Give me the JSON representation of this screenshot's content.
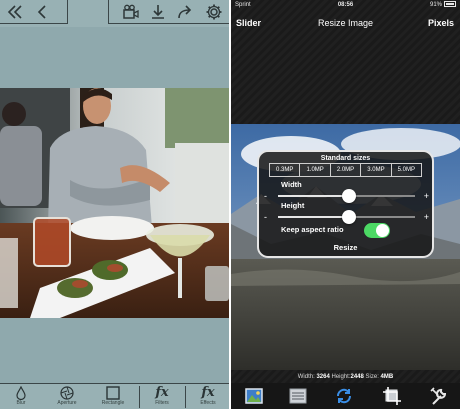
{
  "left_app": {
    "top_toolbar": {
      "icons": [
        "double-chevron-left-icon",
        "chevron-left-icon",
        "video-camera-icon",
        "download-icon",
        "share-arrow-icon",
        "gear-icon"
      ]
    },
    "bottom_toolbar": {
      "tools": [
        {
          "icon": "droplet-icon",
          "label": "Blur"
        },
        {
          "icon": "aperture-icon",
          "label": "Aperture"
        },
        {
          "icon": "square-icon",
          "label": "Rectangle"
        },
        {
          "icon": "fx-icon",
          "glyph": "fx",
          "label": "Filters"
        },
        {
          "icon": "fx-icon",
          "glyph": "fx",
          "label": "Effects"
        }
      ]
    },
    "colors": {
      "background": "#8fa9ad",
      "toolbar": "#98b1b4"
    }
  },
  "right_app": {
    "status_bar": {
      "carrier": "Sprint",
      "time": "08:56",
      "battery": "91%"
    },
    "nav": {
      "left": "Slider",
      "title": "Resize Image",
      "right": "Pixels"
    },
    "panel": {
      "standard_sizes_title": "Standard sizes",
      "sizes": [
        "0.3MP",
        "1.0MP",
        "2.0MP",
        "3.0MP",
        "5.0MP"
      ],
      "width_label": "Width",
      "height_label": "Height",
      "width_value": 0.52,
      "height_value": 0.52,
      "minus": "-",
      "plus": "+",
      "keep_aspect_label": "Keep aspect ratio",
      "keep_aspect_on": true,
      "resize_label": "Resize"
    },
    "info": {
      "width_label": "Width:",
      "width_value": "3264",
      "height_label": "Height:",
      "height_value": "2448",
      "size_label": "Size:",
      "size_value": "4MB"
    },
    "bottom_toolbar": {
      "icons": [
        "photo-icon",
        "list-icon",
        "sync-icon",
        "crop-icon",
        "wrench-icon"
      ]
    },
    "colors": {
      "toggle_on": "#4cd964",
      "sync_accent": "#3a8ee6"
    }
  }
}
